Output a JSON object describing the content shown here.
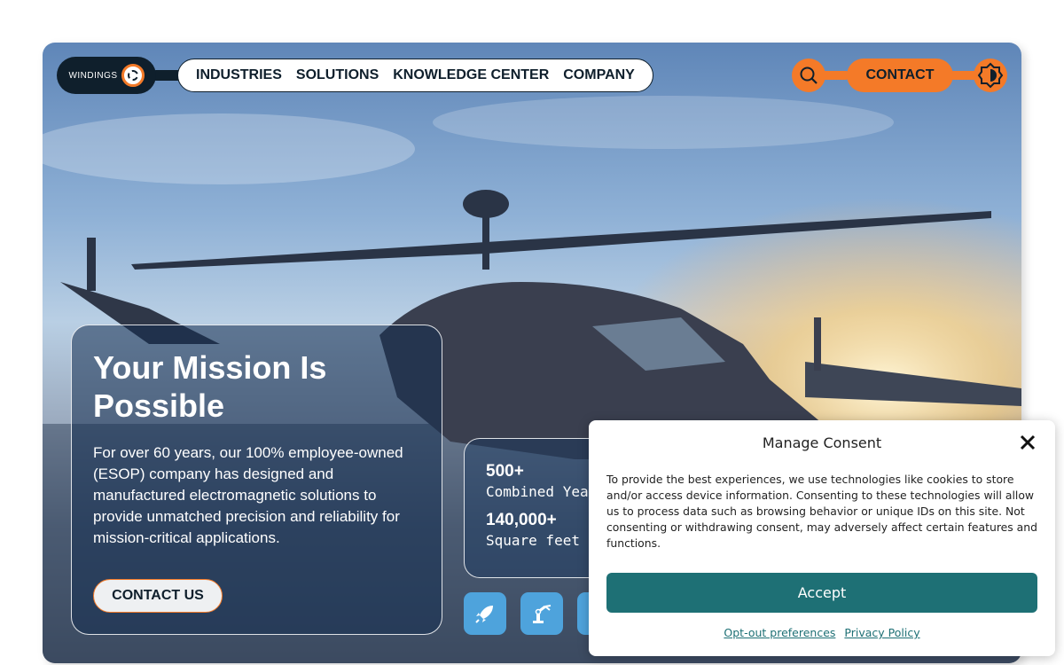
{
  "header": {
    "logo_text": "WINDINGS",
    "nav": [
      "INDUSTRIES",
      "SOLUTIONS",
      "KNOWLEDGE CENTER",
      "COMPANY"
    ],
    "contact_label": "CONTACT",
    "icons": [
      "search-icon",
      "theme-toggle-icon"
    ]
  },
  "hero": {
    "title": "Your Mission Is Possible",
    "body": "For over 60 years, our 100% employee-owned (ESOP) company has designed and manufactured electromagnetic solutions to provide unmatched precision and reliability for mission-critical applications.",
    "cta_label": "CONTACT US"
  },
  "stats": [
    {
      "value": "500+",
      "label": "Combined Yea"
    },
    {
      "value": "140,000+",
      "label": "Square feet"
    }
  ],
  "industry_icons": [
    "rocket-icon",
    "robot-arm-icon",
    "industry-icon"
  ],
  "consent": {
    "title": "Manage Consent",
    "text": "To provide the best experiences, we use technologies like cookies to store and/or access device information. Consenting to these technologies will allow us to process data such as browsing behavior or unique IDs on this site. Not consenting or withdrawing consent, may adversely affect certain features and functions.",
    "accept_label": "Accept",
    "links": [
      "Opt-out preferences",
      "Privacy Policy"
    ]
  },
  "colors": {
    "accent": "#f47a28",
    "navy": "#0f1f2c",
    "accept": "#1e7075",
    "tile": "#4ea3dc"
  }
}
